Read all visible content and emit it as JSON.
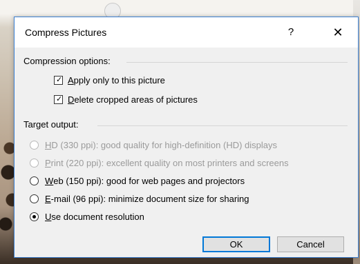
{
  "dialog": {
    "title": "Compress Pictures",
    "help_glyph": "?",
    "close_glyph": "✕"
  },
  "compression": {
    "label": "Compression options:",
    "options": [
      {
        "accel": "A",
        "rest": "pply only to this picture",
        "checked": true
      },
      {
        "accel": "D",
        "rest": "elete cropped areas of pictures",
        "checked": true
      }
    ]
  },
  "target": {
    "label": "Target output:",
    "options": [
      {
        "accel": "H",
        "rest": "D (330 ppi): good quality for high-definition (HD) displays",
        "enabled": false,
        "selected": false
      },
      {
        "accel": "P",
        "rest": "rint (220 ppi): excellent quality on most printers and screens",
        "enabled": false,
        "selected": false
      },
      {
        "accel": "W",
        "rest": "eb (150 ppi): good for web pages and projectors",
        "enabled": true,
        "selected": false
      },
      {
        "accel": "E",
        "rest": "-mail (96 ppi): minimize document size for sharing",
        "enabled": true,
        "selected": false
      },
      {
        "accel": "U",
        "rest": "se document resolution",
        "enabled": true,
        "selected": true
      }
    ]
  },
  "buttons": {
    "ok": "OK",
    "cancel": "Cancel"
  },
  "colors": {
    "dialog_bg": "#f0f0f0",
    "accent": "#0078d7",
    "disabled_text": "#9a9a9a"
  }
}
